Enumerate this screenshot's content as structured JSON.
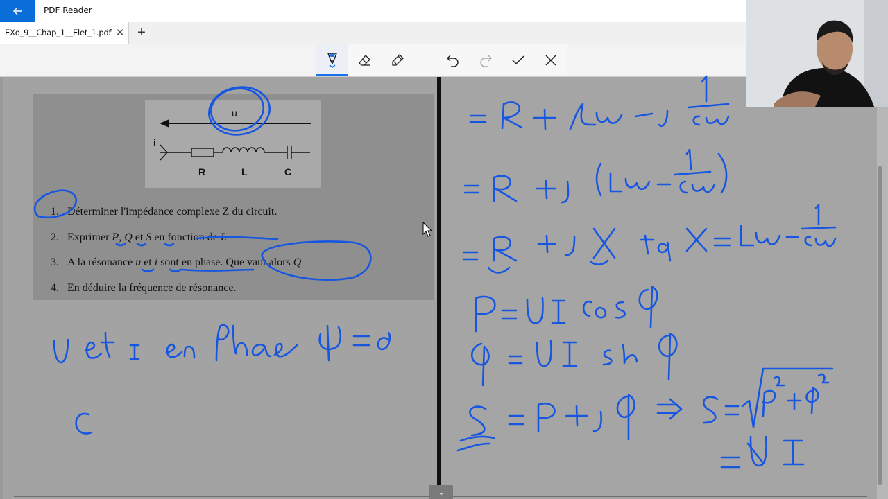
{
  "app": {
    "title": "PDF Reader",
    "back_icon": "arrow-left-icon"
  },
  "tabs": [
    {
      "label": "EXo_9__Chap_1__Elet_1.pdf",
      "close_icon": "close-icon"
    }
  ],
  "tab_add_icon": "plus-icon",
  "ink_toolbar": {
    "tools": [
      {
        "name": "ballpoint-pen",
        "icon": "pen-icon",
        "active": true
      },
      {
        "name": "eraser",
        "icon": "eraser-icon",
        "active": false
      },
      {
        "name": "highlighter",
        "icon": "highlighter-icon",
        "active": false
      },
      {
        "name": "undo",
        "icon": "undo-icon",
        "active": false
      },
      {
        "name": "redo",
        "icon": "redo-icon",
        "active": false
      },
      {
        "name": "accept",
        "icon": "checkmark-icon",
        "active": false
      },
      {
        "name": "cancel",
        "icon": "close-icon",
        "active": false
      }
    ],
    "accent": "#1a73e8"
  },
  "document": {
    "circuit": {
      "voltage_label": "u",
      "current_label": "i",
      "components": [
        "R",
        "L",
        "C"
      ]
    },
    "questions": [
      {
        "num": "1.",
        "text_a": "Déterminer l'impédance complexe ",
        "sym": "Z",
        "text_b": " du circuit."
      },
      {
        "num": "2.",
        "text_a": "Exprimer ",
        "p": "P",
        "c1": ", ",
        "qv": "Q",
        "et": " et ",
        "s": "S",
        "text_b": " en fonction de ",
        "i": "I",
        "end": "."
      },
      {
        "num": "3.",
        "text_a": "A la résonance ",
        "u": "u",
        "et": " et ",
        "i": "i",
        "text_b": " sont en phase. Que vaut alors ",
        "qv": "Q"
      },
      {
        "num": "4.",
        "text": "En déduire la fréquence de résonance."
      }
    ]
  },
  "ink_color": "#1656e0",
  "scroll_down_icon": "chevron-down-icon"
}
